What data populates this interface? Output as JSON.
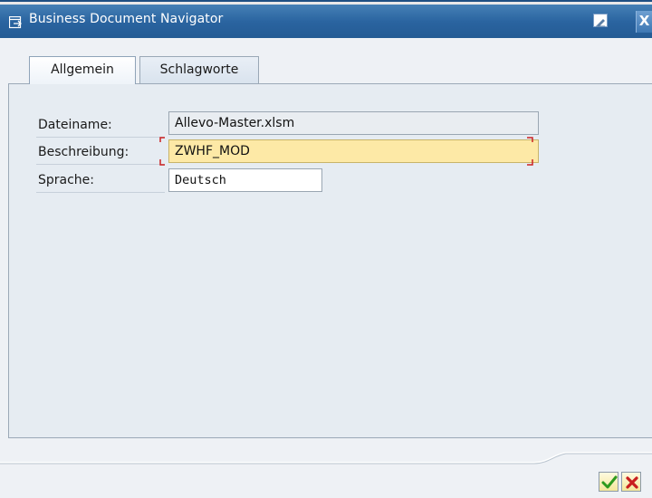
{
  "window": {
    "title": "Business Document Navigator",
    "icons": {
      "app": "window-popup-icon",
      "minimize": "minimize-icon",
      "close": "close-icon"
    },
    "close_glyph": "X"
  },
  "tabs": [
    {
      "label": "Allgemein",
      "active": true
    },
    {
      "label": "Schlagworte",
      "active": false
    }
  ],
  "form": {
    "dateiname_label": "Dateiname:",
    "dateiname_value": "Allevo-Master.xlsm",
    "beschreibung_label": "Beschreibung:",
    "beschreibung_value": "ZWHF_MOD",
    "sprache_label": "Sprache:",
    "sprache_value": "Deutsch"
  },
  "actions": {
    "confirm_icon": "checkmark-icon",
    "cancel_icon": "cancel-x-icon"
  },
  "colors": {
    "title_bar": "#2a64a0",
    "active_field": "#fde9a6",
    "required_marker": "#cc2222",
    "confirm": "#2e9a1e",
    "cancel": "#c81e1e"
  }
}
